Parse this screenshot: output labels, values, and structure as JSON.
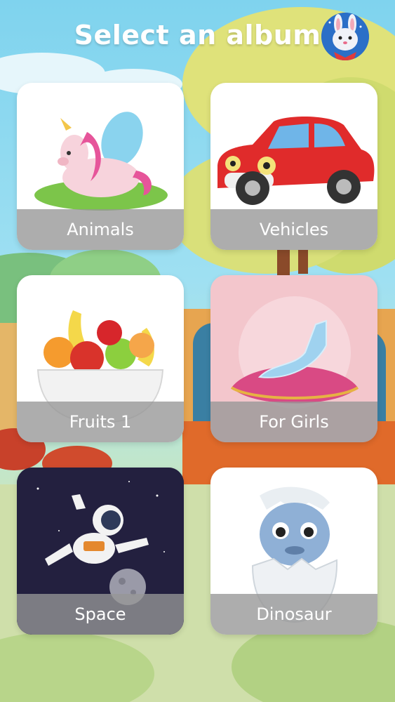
{
  "header": {
    "title": "Select an album",
    "avatar_icon": "bunny-avatar-icon"
  },
  "albums": [
    {
      "label": "Animals",
      "icon": "unicorn-icon"
    },
    {
      "label": "Vehicles",
      "icon": "car-icon"
    },
    {
      "label": "Fruits 1",
      "icon": "fruit-bowl-icon"
    },
    {
      "label": "For Girls",
      "icon": "glass-slipper-icon"
    },
    {
      "label": "Space",
      "icon": "astronaut-icon"
    },
    {
      "label": "Dinosaur",
      "icon": "dinosaur-egg-icon"
    }
  ],
  "colors": {
    "title": "#ffffff",
    "label_bar": "#969696",
    "avatar_bg": "#2b6fc7"
  }
}
